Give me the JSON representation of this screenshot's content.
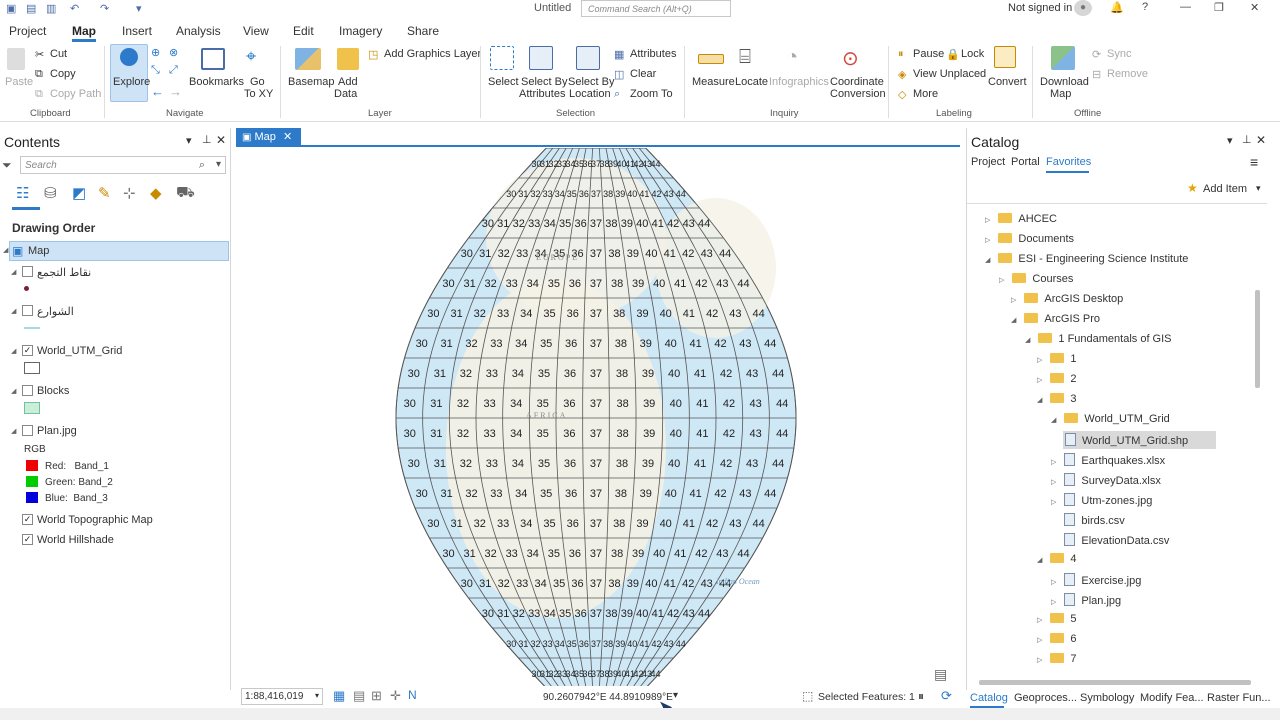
{
  "app": {
    "title": "Untitled",
    "command_search_placeholder": "Command Search (Alt+Q)",
    "sign_in": "Not signed in"
  },
  "tabs": [
    "Project",
    "Map",
    "Insert",
    "Analysis",
    "View",
    "Edit",
    "Imagery",
    "Share"
  ],
  "active_tab": "Map",
  "ribbon": {
    "clipboard": {
      "paste": "Paste",
      "cut": "Cut",
      "copy": "Copy",
      "copy_path": "Copy Path",
      "group": "Clipboard"
    },
    "navigate": {
      "explore": "Explore",
      "bookmarks": "Bookmarks",
      "goto1": "Go",
      "goto2": "To XY",
      "group": "Navigate"
    },
    "layer": {
      "basemap": "Basemap",
      "add1": "Add",
      "add2": "Data",
      "add_graphics": "Add Graphics Layer",
      "group": "Layer"
    },
    "selection": {
      "select": "Select",
      "sba1": "Select By",
      "sba2": "Attributes",
      "sbl1": "Select By",
      "sbl2": "Location",
      "attributes": "Attributes",
      "clear": "Clear",
      "zoom_to": "Zoom To",
      "group": "Selection"
    },
    "inquiry": {
      "measure": "Measure",
      "locate": "Locate",
      "infographics": "Infographics",
      "cc1": "Coordinate",
      "cc2": "Conversion",
      "group": "Inquiry"
    },
    "labeling": {
      "pause": "Pause",
      "lock": "Lock",
      "view_unplaced": "View Unplaced",
      "more": "More",
      "convert": "Convert",
      "group": "Labeling"
    },
    "offline": {
      "dl1": "Download",
      "dl2": "Map",
      "sync": "Sync",
      "remove": "Remove",
      "group": "Offline"
    }
  },
  "contents": {
    "title": "Contents",
    "search_placeholder": "Search",
    "drawing_order": "Drawing Order",
    "map": "Map",
    "layers": [
      "نقاط التجمع",
      "الشوارع",
      "World_UTM_Grid",
      "Blocks",
      "Plan.jpg"
    ],
    "rgb": {
      "label": "RGB",
      "red": "Red:   Band_1",
      "green": "Green: Band_2",
      "blue": "Blue:  Band_3"
    },
    "basemaps": [
      "World Topographic Map",
      "World Hillshade"
    ]
  },
  "map": {
    "tab": "Map",
    "scale": "1:88,416,019",
    "coords": "90.2607942°E 44.8910989°E",
    "selected": "Selected Features: 1",
    "labels": {
      "africa": "AFRICA",
      "ocean": "Indian Ocean",
      "europe": "EUROPE"
    },
    "zone_min": 30,
    "zone_max": 44
  },
  "catalog": {
    "title": "Catalog",
    "tabs": [
      "Project",
      "Portal",
      "Favorites"
    ],
    "active_tab": "Favorites",
    "add_item": "Add Item",
    "items": [
      {
        "label": "AHCEC",
        "type": "folder",
        "level": 0
      },
      {
        "label": "Documents",
        "type": "folder",
        "level": 0
      },
      {
        "label": "ESI - Engineering Science Institute",
        "type": "folder",
        "level": 0
      },
      {
        "label": "Courses",
        "type": "folder",
        "level": 1
      },
      {
        "label": "ArcGIS Desktop",
        "type": "folder",
        "level": 2
      },
      {
        "label": "ArcGIS Pro",
        "type": "folder",
        "level": 2
      },
      {
        "label": "1 Fundamentals of GIS",
        "type": "folder",
        "level": 3
      },
      {
        "label": "1",
        "type": "folder",
        "level": 4
      },
      {
        "label": "2",
        "type": "folder",
        "level": 4
      },
      {
        "label": "3",
        "type": "folder",
        "level": 4
      },
      {
        "label": "World_UTM_Grid",
        "type": "folder",
        "level": 5
      },
      {
        "label": "World_UTM_Grid.shp",
        "type": "file",
        "level": 6,
        "selected": true
      },
      {
        "label": "Earthquakes.xlsx",
        "type": "file",
        "level": 5
      },
      {
        "label": "SurveyData.xlsx",
        "type": "file",
        "level": 5
      },
      {
        "label": "Utm-zones.jpg",
        "type": "file",
        "level": 5
      },
      {
        "label": "birds.csv",
        "type": "file",
        "level": 5
      },
      {
        "label": "ElevationData.csv",
        "type": "file",
        "level": 5
      },
      {
        "label": "4",
        "type": "folder",
        "level": 4
      },
      {
        "label": "Exercise.jpg",
        "type": "file",
        "level": 5
      },
      {
        "label": "Plan.jpg",
        "type": "file",
        "level": 5
      },
      {
        "label": "5",
        "type": "folder",
        "level": 4
      },
      {
        "label": "6",
        "type": "folder",
        "level": 4
      },
      {
        "label": "7",
        "type": "folder",
        "level": 4
      }
    ]
  },
  "bottom_tabs": [
    "Catalog",
    "Geoproces...",
    "Symbology",
    "Modify Fea...",
    "Raster Fun..."
  ],
  "colors": {
    "accent": "#2c7ac9",
    "ocean": "#cfe8f6",
    "land": "#f4f1e6"
  }
}
